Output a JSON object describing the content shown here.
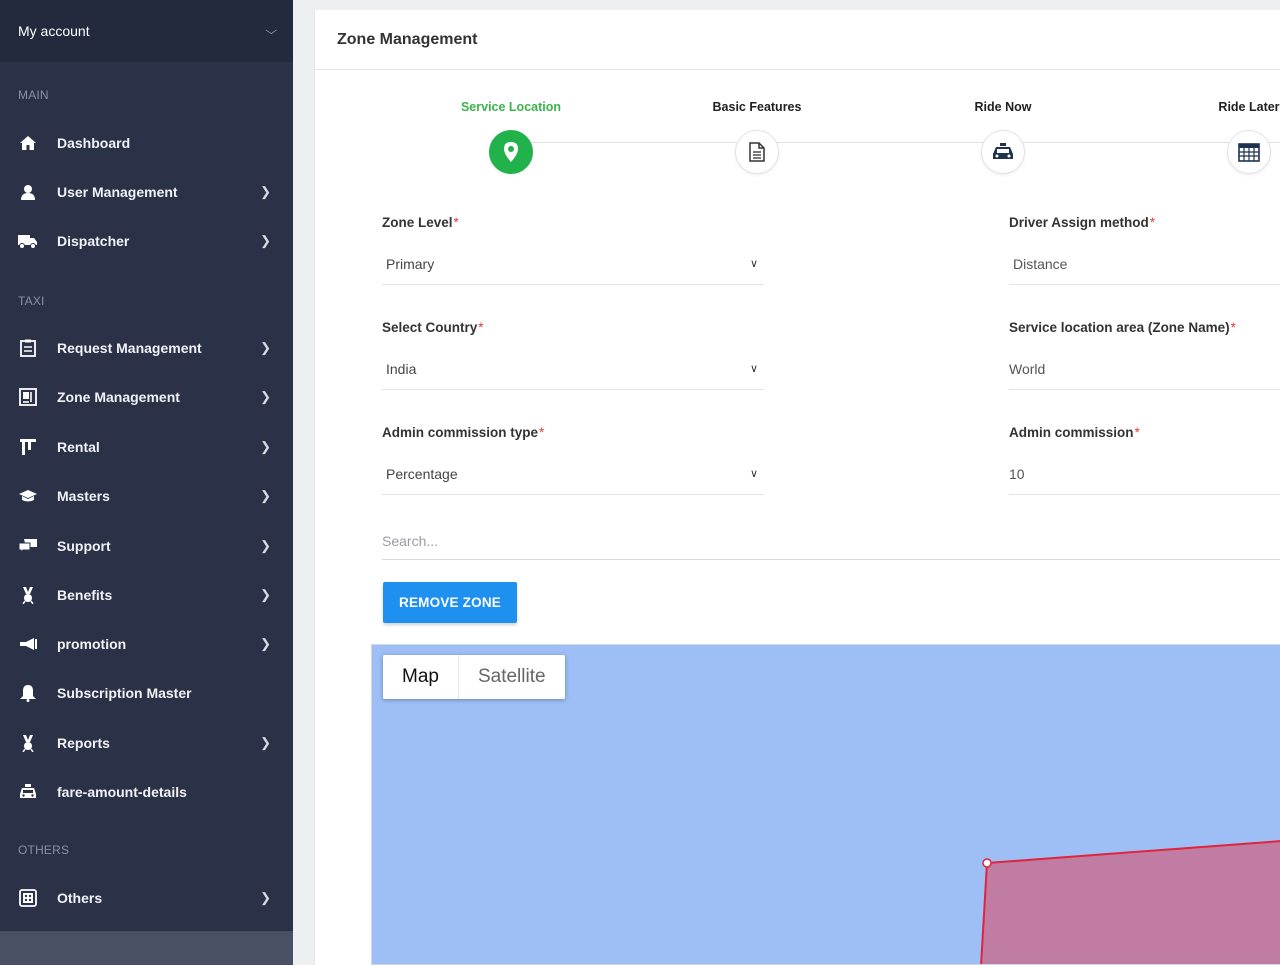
{
  "sidebar": {
    "account_label": "My account",
    "sections": {
      "main": "MAIN",
      "taxi": "TAXI",
      "others": "OTHERS"
    },
    "items": [
      {
        "label": "Dashboard",
        "icon": "home-icon",
        "has_arrow": false
      },
      {
        "label": "User Management",
        "icon": "user-icon",
        "has_arrow": true
      },
      {
        "label": "Dispatcher",
        "icon": "truck-icon",
        "has_arrow": true
      },
      {
        "label": "Request Management",
        "icon": "clipboard-icon",
        "has_arrow": true
      },
      {
        "label": "Zone Management",
        "icon": "map-board-icon",
        "has_arrow": true
      },
      {
        "label": "Rental",
        "icon": "rental-icon",
        "has_arrow": true
      },
      {
        "label": "Masters",
        "icon": "graduation-cap-icon",
        "has_arrow": true
      },
      {
        "label": "Support",
        "icon": "chat-icon",
        "has_arrow": true
      },
      {
        "label": "Benefits",
        "icon": "award-icon",
        "has_arrow": true
      },
      {
        "label": "promotion",
        "icon": "megaphone-icon",
        "has_arrow": true
      },
      {
        "label": "Subscription Master",
        "icon": "bell-icon",
        "has_arrow": false
      },
      {
        "label": "Reports",
        "icon": "medal-icon",
        "has_arrow": true
      },
      {
        "label": "fare-amount-details",
        "icon": "taxi-icon",
        "has_arrow": false
      },
      {
        "label": "Others",
        "icon": "dice-icon",
        "has_arrow": true
      }
    ]
  },
  "main": {
    "title": "Zone Management",
    "steps": [
      {
        "label": "Service Location",
        "icon": "location-pin-icon",
        "active": true
      },
      {
        "label": "Basic Features",
        "icon": "document-icon",
        "active": false
      },
      {
        "label": "Ride Now",
        "icon": "car-icon",
        "active": false
      },
      {
        "label": "Ride Later",
        "icon": "calendar-icon",
        "active": false
      }
    ],
    "form": {
      "zone_level": {
        "label": "Zone Level",
        "value": "Primary"
      },
      "driver_assign": {
        "label": "Driver Assign method",
        "value": "Distance"
      },
      "country": {
        "label": "Select Country",
        "value": "India"
      },
      "zone_name": {
        "label": "Service location area (Zone Name)",
        "value": "World"
      },
      "commission_type": {
        "label": "Admin commission type",
        "value": "Percentage"
      },
      "commission": {
        "label": "Admin commission",
        "value": "10"
      },
      "required_mark": "*"
    },
    "search_placeholder": "Search...",
    "remove_zone_label": "REMOVE ZONE",
    "map": {
      "type_map": "Map",
      "type_satellite": "Satellite"
    }
  },
  "colors": {
    "sidebar_bg": "#2b3147",
    "active_step": "#22b24c",
    "primary_button": "#1e90f0",
    "map_water": "#9dbff5",
    "zone_fill": "#c07ca3",
    "zone_stroke": "#e0243a"
  }
}
